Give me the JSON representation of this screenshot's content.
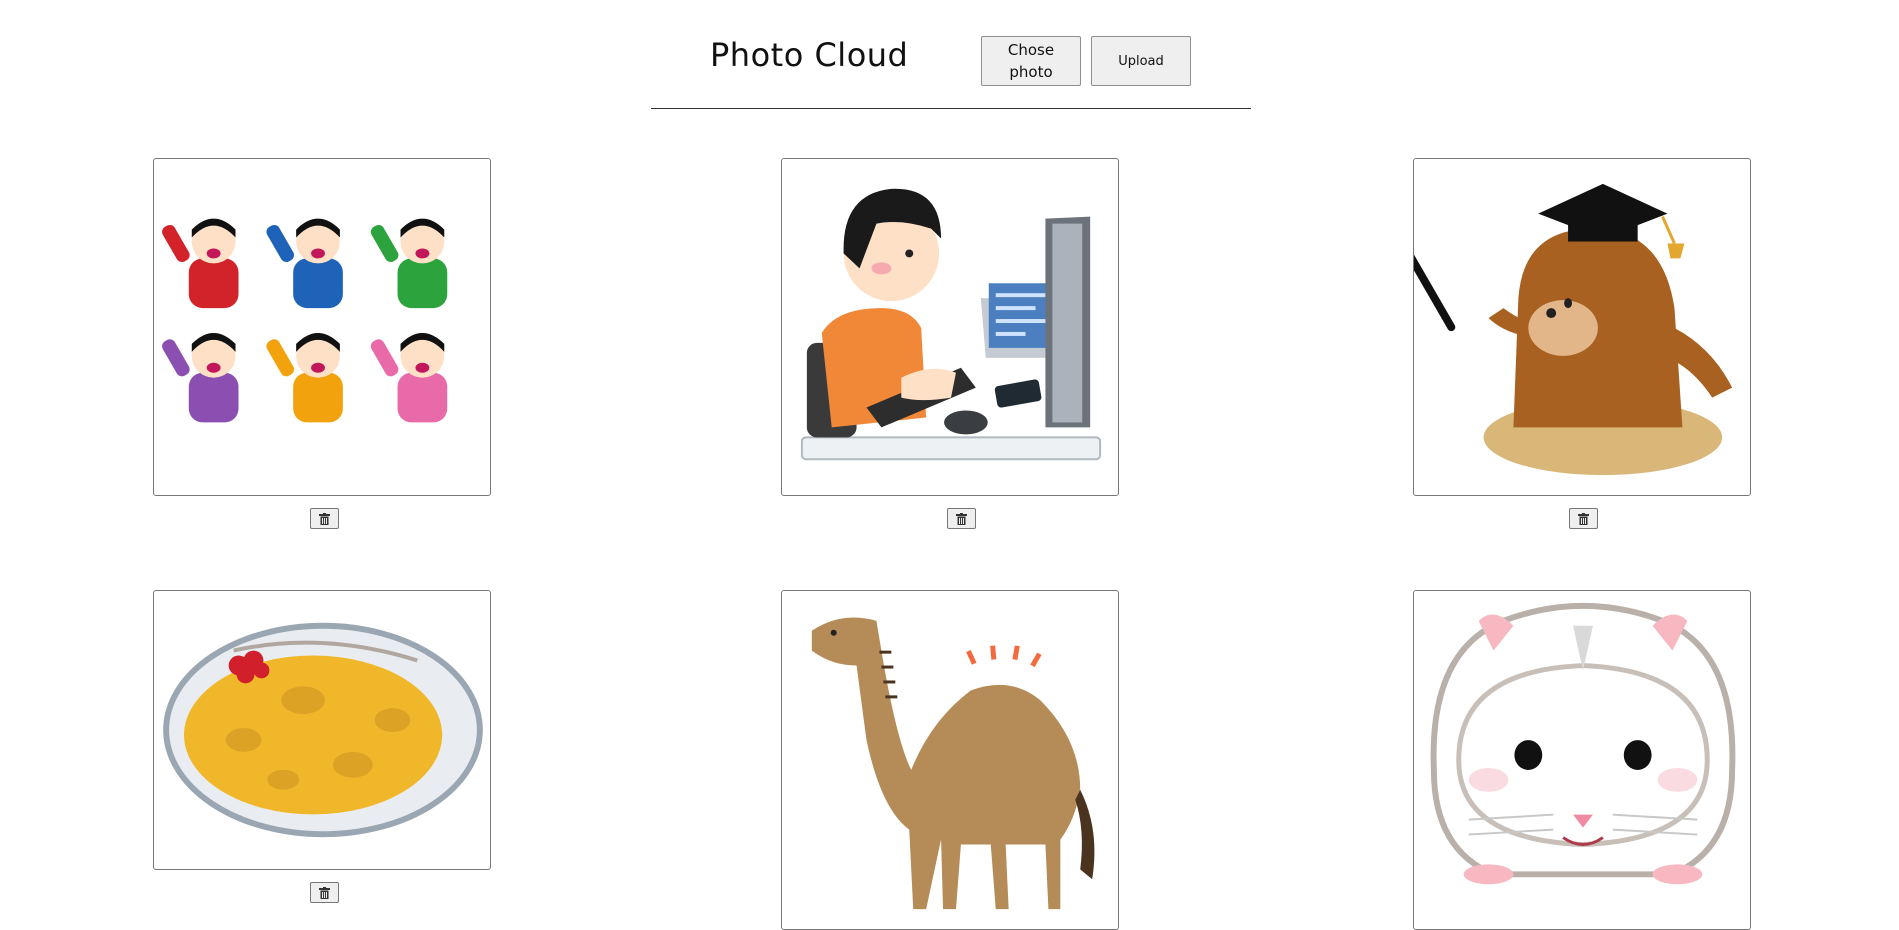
{
  "header": {
    "title": "Photo Cloud",
    "choose_label": "Chose photo",
    "upload_label": "Upload"
  },
  "gallery": {
    "photos": [
      {
        "subject": "six boys cheering in colored jerseys",
        "delete_icon": "trash-icon"
      },
      {
        "subject": "boy typing at computer",
        "delete_icon": "trash-icon"
      },
      {
        "subject": "mole with graduation cap and pointer",
        "delete_icon": "trash-icon"
      },
      {
        "subject": "curry rice plate",
        "delete_icon": "trash-icon"
      },
      {
        "subject": "camel",
        "delete_icon": "trash-icon"
      },
      {
        "subject": "white hamster face",
        "delete_icon": "trash-icon"
      }
    ]
  },
  "colors": {
    "button_bg": "#efefef",
    "border": "#777777",
    "divider": "#333333"
  }
}
